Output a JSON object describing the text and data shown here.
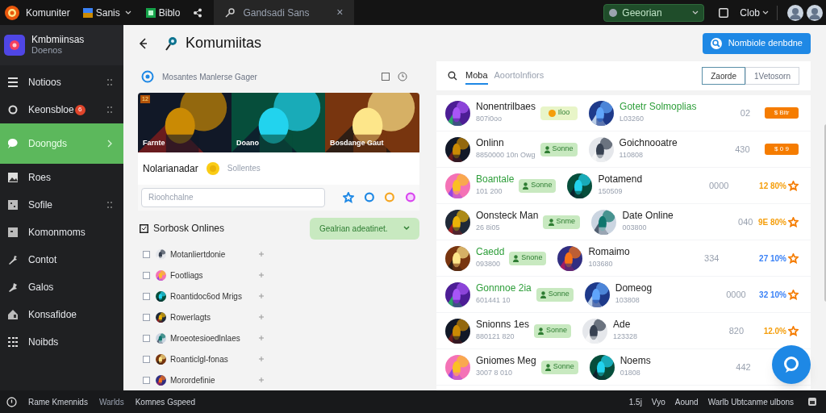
{
  "topbar": {
    "app_name": "Komuniter",
    "tabs": [
      {
        "label": "Sanis",
        "selected": false,
        "dropdown": true
      },
      {
        "label": "Biblo",
        "selected": false,
        "dropdown": false
      }
    ],
    "search_tab": {
      "label": "Gandsadi Sans",
      "close": "×"
    },
    "status_dropdown": "Geeorian",
    "user_menu": "Clob"
  },
  "sidebar": {
    "title": "Kmbmiinsas",
    "subtitle": "Doenos",
    "items": [
      {
        "label": "Notioos",
        "selected": false,
        "handle": true
      },
      {
        "label": "Keonsbloe",
        "selected": false,
        "handle": true,
        "badge": "6"
      },
      {
        "label": "Doongds",
        "selected": true,
        "handle": false
      },
      {
        "label": "Roes",
        "selected": false,
        "handle": false
      },
      {
        "label": "Sofile",
        "selected": false,
        "handle": true
      },
      {
        "label": "Komonmoms",
        "selected": false,
        "handle": false
      },
      {
        "label": "Contot",
        "selected": false,
        "handle": false
      },
      {
        "label": "Galos",
        "selected": false,
        "handle": false
      },
      {
        "label": "Konsafidoe",
        "selected": false,
        "handle": false
      },
      {
        "label": "Noibds",
        "selected": false,
        "handle": false
      }
    ]
  },
  "main": {
    "title": "Komumiitas",
    "action_button": "Nombiole denbdne",
    "left_panel": {
      "header": "Mosantes Manlerse Gager",
      "banners": [
        {
          "caption": "Farnte",
          "badge": "12"
        },
        {
          "caption": "Doano"
        },
        {
          "caption": "Bosdange Gaut"
        }
      ],
      "name": "Nolarianadar",
      "status": "Sollentes",
      "search": {
        "placeholder": "Rioohchalne"
      },
      "section_title": "Sorbosk Onlines",
      "filter_dropdown": "Gealrian adeatinet.",
      "members": [
        {
          "name": "Motanliertdonie",
          "checked": false
        },
        {
          "name": "Footliags",
          "checked": false
        },
        {
          "name": "Roantidoc6od Mrigs",
          "checked": false
        },
        {
          "name": "Rowerlagts",
          "checked": false
        },
        {
          "name": "Mroeotesioedlnlaes",
          "checked": false
        },
        {
          "name": "Roanticlgl-fonas",
          "checked": false
        },
        {
          "name": "Morordefinie",
          "checked": false
        }
      ]
    },
    "right_panel": {
      "tabs": [
        {
          "label": "Moba",
          "selected": true
        },
        {
          "label": "Aoortolnfiors",
          "selected": false
        }
      ],
      "segments": [
        {
          "label": "Zaorde",
          "selected": true
        },
        {
          "label": "1Vetosorn",
          "selected": false
        }
      ],
      "rows": [
        {
          "left": {
            "name": "Nonentrilbaes",
            "sub": "807i0oo",
            "featured": false,
            "kind": "coin",
            "badge": "Iloo"
          },
          "right": {
            "name": "Gotetr Solmoplias",
            "sub": "L03260",
            "featured": true,
            "count": "02",
            "kind": "tag",
            "value": "$ Bitr"
          }
        },
        {
          "left": {
            "name": "Onlinn",
            "sub": "8850000 10n Owg",
            "featured": false,
            "kind": "person",
            "badge": "Sonne"
          },
          "right": {
            "name": "Goichnooatre",
            "sub": "110808",
            "featured": false,
            "count": "430",
            "kind": "tag",
            "value": "$ 0 9"
          }
        },
        {
          "left": {
            "name": "Boantale",
            "sub": "101 200",
            "featured": true,
            "kind": "person",
            "badge": "Sonne"
          },
          "right": {
            "name": "Potamend",
            "sub": "150509",
            "featured": false,
            "count": "0000",
            "kind": "percent",
            "value": "12 80%",
            "color": "#f59e0b"
          }
        },
        {
          "left": {
            "name": "Oonsteck Man",
            "sub": "26 8i05",
            "featured": false,
            "kind": "person",
            "badge": "Snme"
          },
          "right": {
            "name": "Date Online",
            "sub": "003800",
            "featured": false,
            "count": "040",
            "kind": "percent",
            "value": "9E 80%",
            "color": "#f59e0b"
          }
        },
        {
          "left": {
            "name": "Caedd",
            "sub": "093800",
            "featured": true,
            "kind": "person",
            "badge": "Snone"
          },
          "right": {
            "name": "Romaimo",
            "sub": "103680",
            "featured": false,
            "count": "334",
            "kind": "percent",
            "value": "27 10%",
            "color": "#3b82f6"
          }
        },
        {
          "left": {
            "name": "Gonnnoe 2ia",
            "sub": "601441 10",
            "featured": true,
            "kind": "person",
            "badge": "Sonne"
          },
          "right": {
            "name": "Domeog",
            "sub": "103808",
            "featured": false,
            "count": "0000",
            "kind": "percent",
            "value": "32 10%",
            "color": "#3b82f6"
          }
        },
        {
          "left": {
            "name": "Snionns 1es",
            "sub": "880121 820",
            "featured": false,
            "kind": "person",
            "badge": "Sonne"
          },
          "right": {
            "name": "Ade",
            "sub": "123328",
            "featured": false,
            "count": "820",
            "kind": "percent",
            "value": "12.0%",
            "color": "#f59e0b"
          }
        },
        {
          "left": {
            "name": "Gniomes Meg",
            "sub": "3007 8 010",
            "featured": false,
            "kind": "person",
            "badge": "Sonne"
          },
          "right": {
            "name": "Noems",
            "sub": "01808",
            "featured": false,
            "count": "442"
          }
        }
      ]
    }
  },
  "footer": {
    "left": [
      "Rame Kmennids",
      "Warlds",
      "Komnes Gspeed"
    ],
    "right": [
      "1.5j",
      "Vyo",
      "Aound",
      "Warlb Ubtcanme ulbons"
    ]
  }
}
